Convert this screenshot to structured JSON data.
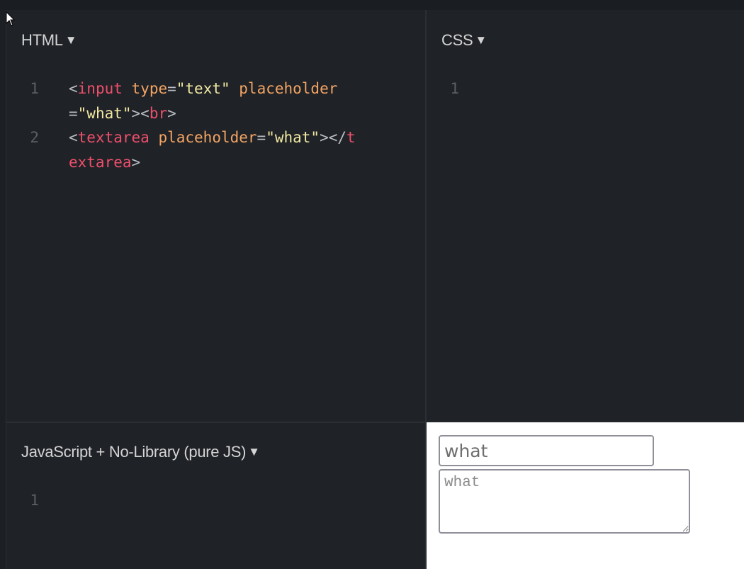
{
  "panels": {
    "html": {
      "title": "HTML",
      "lines": [
        {
          "number": "1",
          "tokens": [
            {
              "t": "<",
              "c": "punc"
            },
            {
              "t": "input",
              "c": "tag"
            },
            {
              "t": " ",
              "c": "punc"
            },
            {
              "t": "type",
              "c": "attr"
            },
            {
              "t": "=",
              "c": "punc"
            },
            {
              "t": "\"text\"",
              "c": "str"
            },
            {
              "t": " ",
              "c": "punc"
            },
            {
              "t": "placeholder",
              "c": "attr"
            },
            {
              "t": "=",
              "c": "punc"
            },
            {
              "t": "\"what\"",
              "c": "str"
            },
            {
              "t": "><",
              "c": "punc"
            },
            {
              "t": "br",
              "c": "tag"
            },
            {
              "t": ">",
              "c": "punc"
            }
          ]
        },
        {
          "number": "2",
          "tokens": [
            {
              "t": "<",
              "c": "punc"
            },
            {
              "t": "textarea",
              "c": "tag"
            },
            {
              "t": " ",
              "c": "punc"
            },
            {
              "t": "placeholder",
              "c": "attr"
            },
            {
              "t": "=",
              "c": "punc"
            },
            {
              "t": "\"what\"",
              "c": "str"
            },
            {
              "t": "></",
              "c": "punc"
            },
            {
              "t": "textarea",
              "c": "tag"
            },
            {
              "t": ">",
              "c": "punc"
            }
          ]
        }
      ]
    },
    "css": {
      "title": "CSS",
      "lines": [
        {
          "number": "1",
          "tokens": []
        }
      ]
    },
    "js": {
      "title": "JavaScript + No-Library (pure JS)",
      "lines": [
        {
          "number": "1",
          "tokens": []
        }
      ]
    }
  },
  "dropdown_icon": "▼",
  "preview": {
    "input_placeholder": "what",
    "textarea_placeholder": "what"
  },
  "colors": {
    "tag": "#ef4f6b",
    "attr": "#f3a463",
    "string": "#f1e9a2",
    "punctuation": "#b9bcc2",
    "line_number": "#5b5f66",
    "editor_bg": "#1f2227"
  }
}
